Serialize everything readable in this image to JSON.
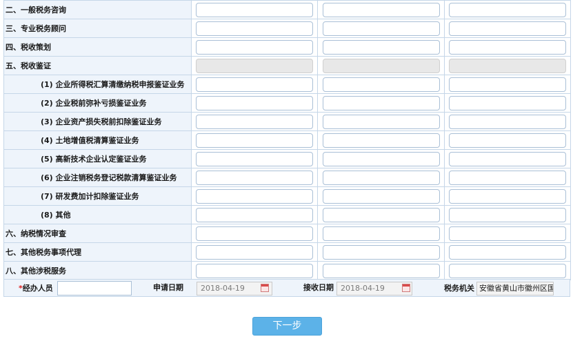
{
  "rows": [
    {
      "label": "二、一般税务咨询",
      "sub": false,
      "disabled": false
    },
    {
      "label": "三、专业税务顾问",
      "sub": false,
      "disabled": false
    },
    {
      "label": "四、税收策划",
      "sub": false,
      "disabled": false
    },
    {
      "label": "五、税收鉴证",
      "sub": false,
      "disabled": true
    },
    {
      "label": "(1) 企业所得税汇算清缴纳税申报鉴证业务",
      "sub": true,
      "disabled": false
    },
    {
      "label": "(2) 企业税前弥补亏损鉴证业务",
      "sub": true,
      "disabled": false
    },
    {
      "label": "(3) 企业资产损失税前扣除鉴证业务",
      "sub": true,
      "disabled": false
    },
    {
      "label": "(4) 土地增值税清算鉴证业务",
      "sub": true,
      "disabled": false
    },
    {
      "label": "(5) 高新技术企业认定鉴证业务",
      "sub": true,
      "disabled": false
    },
    {
      "label": "(6) 企业注销税务登记税款清算鉴证业务",
      "sub": true,
      "disabled": false
    },
    {
      "label": "(7) 研发费加计扣除鉴证业务",
      "sub": true,
      "disabled": false
    },
    {
      "label": "(8) 其他",
      "sub": true,
      "disabled": false
    },
    {
      "label": "六、纳税情况审查",
      "sub": false,
      "disabled": false
    },
    {
      "label": "七、其他税务事项代理",
      "sub": false,
      "disabled": false
    },
    {
      "label": "八、其他涉税服务",
      "sub": false,
      "disabled": false
    }
  ],
  "footer": {
    "required_mark": "*",
    "handler_label": "经办人员",
    "handler_value": "",
    "apply_date_label": "申请日期",
    "apply_date_value": "2018-04-19",
    "receive_date_label": "接收日期",
    "receive_date_value": "2018-04-19",
    "tax_office_label": "税务机关",
    "tax_office_value": "安徽省黄山市徽州区国"
  },
  "next_button_label": "下一步"
}
